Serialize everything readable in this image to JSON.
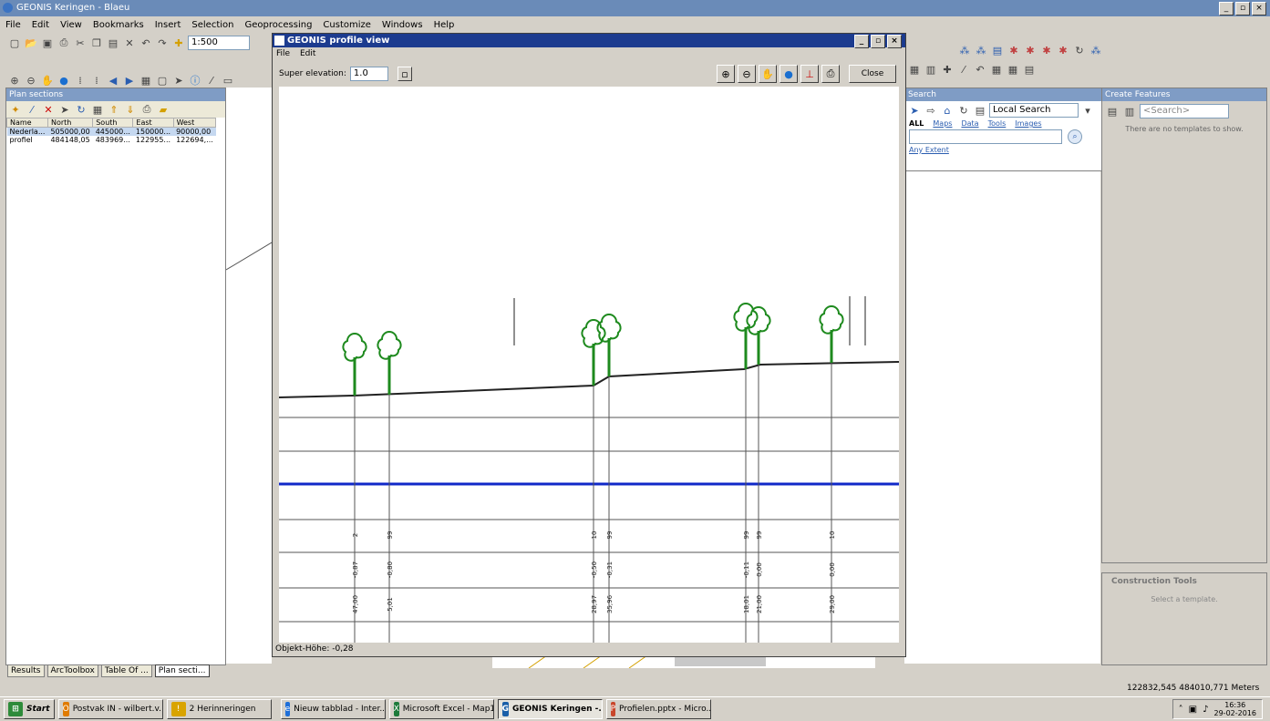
{
  "app": {
    "title": "GEONIS Keringen - Blaeu",
    "menu": [
      "File",
      "Edit",
      "View",
      "Bookmarks",
      "Insert",
      "Selection",
      "Geoprocessing",
      "Customize",
      "Windows",
      "Help"
    ],
    "scale": "1:500"
  },
  "plan_sections": {
    "header": "Plan sections",
    "columns": [
      "Name",
      "North",
      "South",
      "East",
      "West"
    ],
    "rows": [
      {
        "name": "Nederla...",
        "north": "505000,00",
        "south": "445000...",
        "east": "150000...",
        "west": "90000,00"
      },
      {
        "name": "profiel",
        "north": "484148,05",
        "south": "483969...",
        "east": "122955...",
        "west": "122694,..."
      }
    ],
    "tabs": [
      "Results",
      "ArcToolbox",
      "Table Of ...",
      "Plan secti..."
    ]
  },
  "profile_dialog": {
    "title": "GEONIS profile view",
    "menu": [
      "File",
      "Edit"
    ],
    "super_elevation_label": "Super elevation:",
    "super_elevation_value": "1.0",
    "close_label": "Close",
    "status": "Objekt-Höhe: -0,28",
    "columns": [
      {
        "row1": "2",
        "row2": "-0,87",
        "row3": "47,00"
      },
      {
        "row1": "99",
        "row2": "-0,80",
        "row3": "5,01"
      },
      {
        "row1": "10",
        "row2": "-0,50",
        "row3": "28,97"
      },
      {
        "row1": "99",
        "row2": "-0,31",
        "row3": "35,96"
      },
      {
        "row1": "99",
        "row2": "-0,11",
        "row3": "18,01"
      },
      {
        "row1": "99",
        "row2": "0,00",
        "row3": "21,00"
      },
      {
        "row1": "10",
        "row2": "0,00",
        "row3": "29,00"
      }
    ]
  },
  "search_panel": {
    "header": "Search",
    "mode": "Local Search",
    "filters": [
      "ALL",
      "Maps",
      "Data",
      "Tools",
      "Images"
    ],
    "extent": "Any Extent"
  },
  "create_features": {
    "header": "Create Features",
    "search_placeholder": "<Search>",
    "empty_text": "There are no templates to show.",
    "construction_header": "Construction Tools",
    "construction_text": "Select a template."
  },
  "statusbar": {
    "coords": "122832,545  484010,771 Meters"
  },
  "taskbar": {
    "start": "Start",
    "items": [
      {
        "label": "Postvak IN - wilbert.v...",
        "icon": "outlook-icon",
        "color": "#e07b00"
      },
      {
        "label": "2 Herinneringen",
        "icon": "reminder-icon",
        "color": "#d9a400"
      },
      {
        "label": "Nieuw tabblad - Inter...",
        "icon": "ie-icon",
        "color": "#1e6fd9"
      },
      {
        "label": "Microsoft Excel - Map1",
        "icon": "excel-icon",
        "color": "#1d7a3a"
      },
      {
        "label": "GEONIS Keringen -...",
        "icon": "geonis-icon",
        "color": "#1a5fa8"
      },
      {
        "label": "Profielen.pptx - Micro...",
        "icon": "powerpoint-icon",
        "color": "#c8462b"
      }
    ],
    "time": "16:36",
    "date": "29-02-2016"
  }
}
